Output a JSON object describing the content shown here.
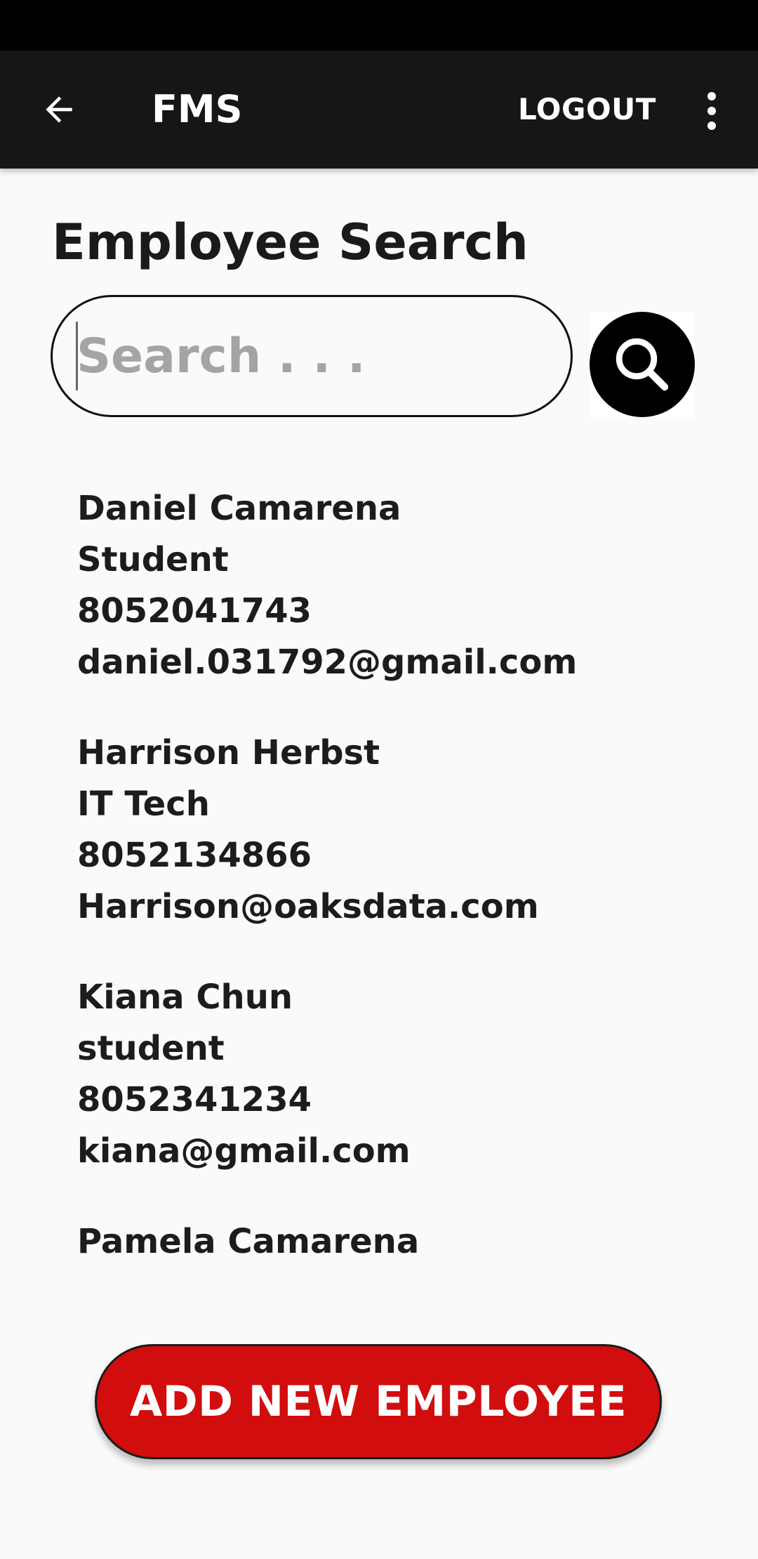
{
  "app_bar": {
    "title": "FMS",
    "logout_label": "LOGOUT",
    "icons": {
      "back": "arrow-left-icon",
      "overflow": "more-vert-icon"
    },
    "background": "#161616"
  },
  "page": {
    "title": "Employee Search"
  },
  "search": {
    "placeholder": "Search . . .",
    "value": "",
    "button_icon": "search-icon"
  },
  "employees": [
    {
      "name": "Daniel Camarena",
      "role": "Student",
      "phone": "8052041743",
      "email": "daniel.031792@gmail.com"
    },
    {
      "name": "Harrison Herbst",
      "role": "IT Tech",
      "phone": "8052134866",
      "email": "Harrison@oaksdata.com"
    },
    {
      "name": "Kiana Chun",
      "role": "student",
      "phone": "8052341234",
      "email": "kiana@gmail.com"
    },
    {
      "name": "Pamela Camarena"
    }
  ],
  "actions": {
    "add_employee_label": "ADD NEW EMPLOYEE",
    "accent_color": "#d20d0d"
  }
}
